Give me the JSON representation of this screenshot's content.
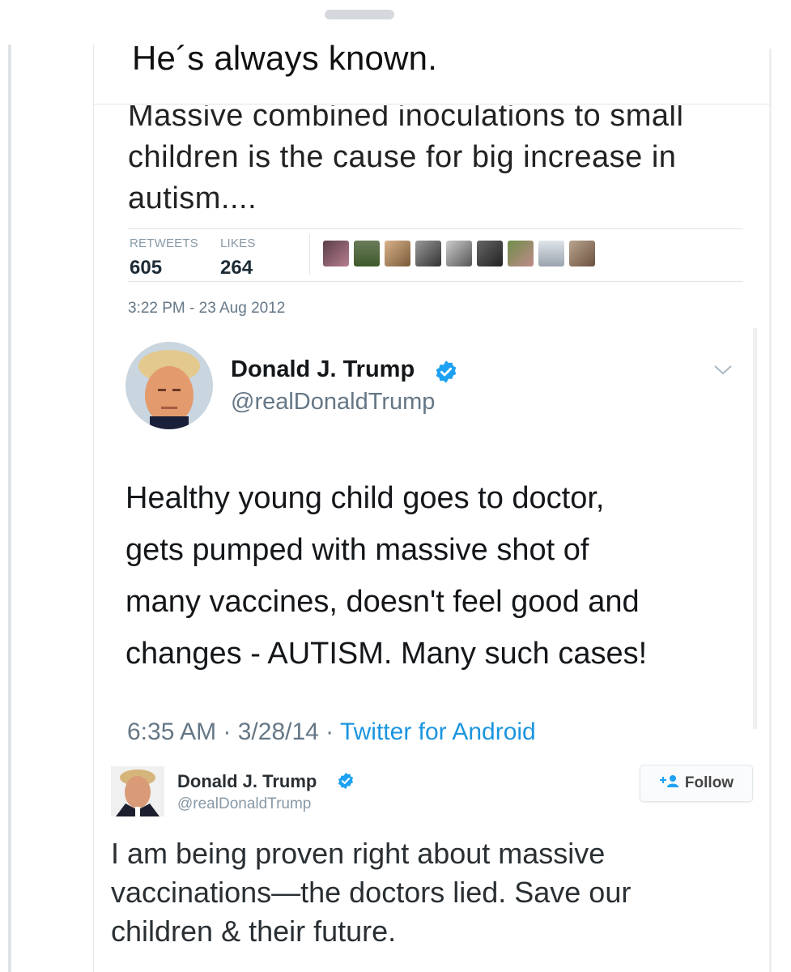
{
  "caption": "He´s always known.",
  "tweet1": {
    "text": "Massive combined inoculations to small children is the cause for big increase in autism....",
    "retweets_label": "RETWEETS",
    "retweets": "605",
    "likes_label": "LIKES",
    "likes": "264",
    "timestamp": "3:22 PM - 23 Aug 2012"
  },
  "tweet2": {
    "name": "Donald J. Trump",
    "handle": "@realDonaldTrump",
    "body_lines": [
      "Healthy young child goes to doctor,",
      "gets pumped with massive shot of",
      "many vaccines, doesn't feel good and",
      "changes - AUTISM. Many such cases!"
    ],
    "time": "6:35 AM",
    "date": "3/28/14",
    "source": "Twitter for Android",
    "sep": " · "
  },
  "tweet3": {
    "name": "Donald J. Trump",
    "handle": "@realDonaldTrump",
    "follow_label": "Follow",
    "body_lines": [
      "I am being proven right about massive",
      "vaccinations—the doctors lied. Save our",
      "children & their future."
    ]
  },
  "colors": {
    "verified": "#1da1f2",
    "link": "#1b95e0"
  }
}
